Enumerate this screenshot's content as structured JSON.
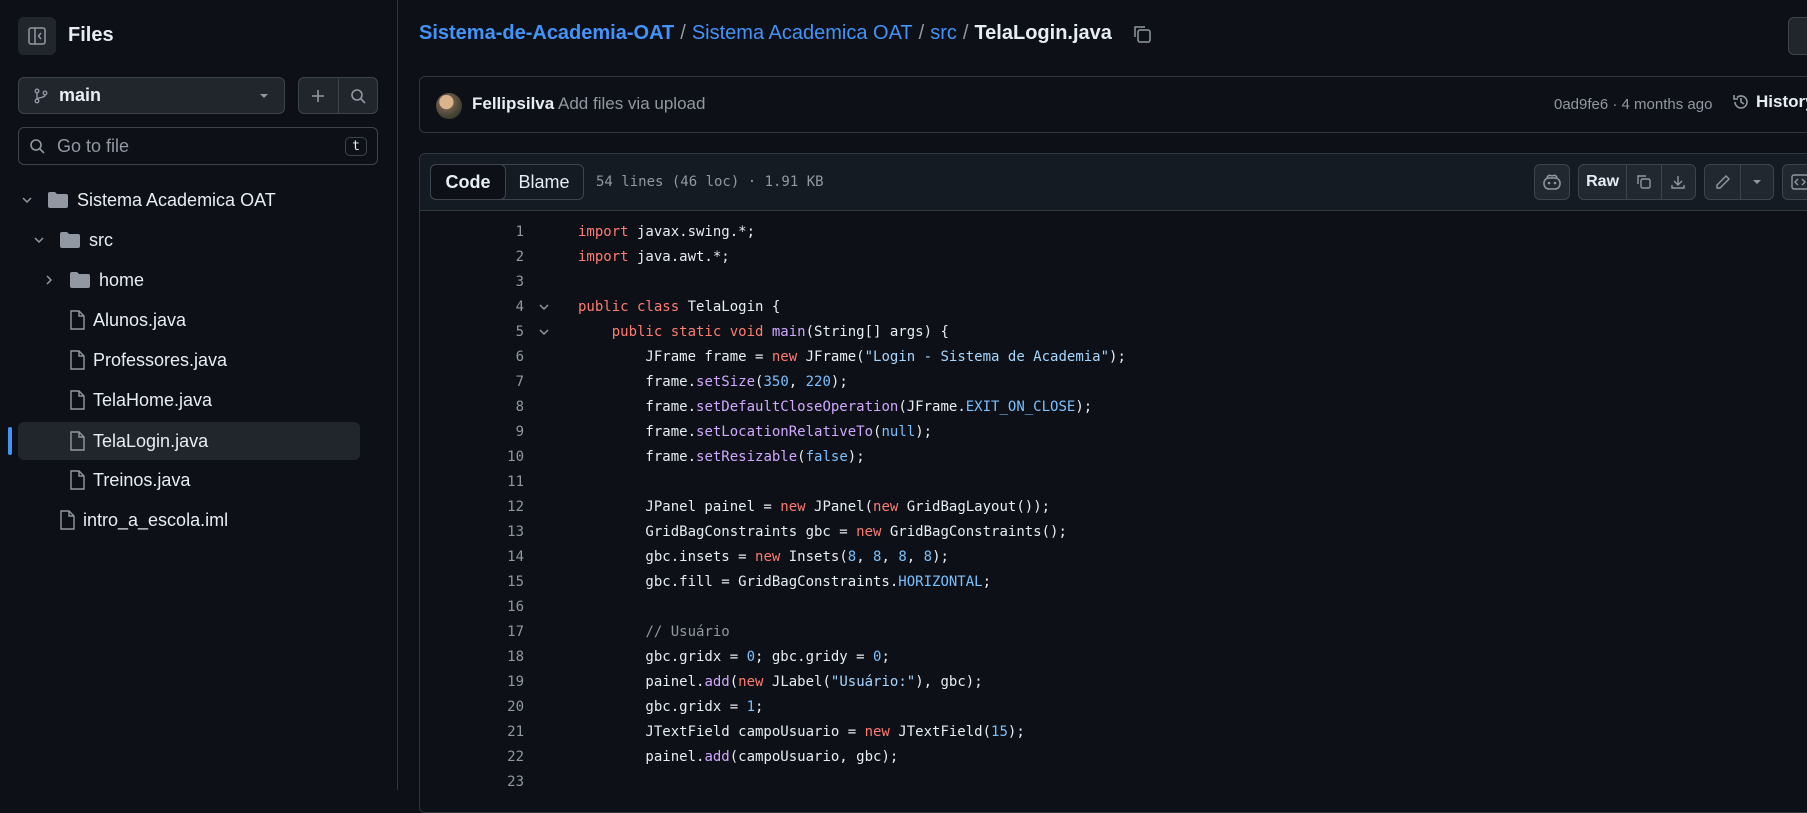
{
  "sidebar": {
    "title": "Files",
    "branch": "main",
    "goto_placeholder": "Go to file",
    "goto_shortcut": "t",
    "tree": [
      {
        "label": "Sistema Academica OAT",
        "type": "folder",
        "expanded": true
      },
      {
        "label": "src",
        "type": "folder",
        "expanded": true
      },
      {
        "label": "home",
        "type": "folder",
        "expanded": false
      },
      {
        "label": "Alunos.java",
        "type": "file"
      },
      {
        "label": "Professores.java",
        "type": "file"
      },
      {
        "label": "TelaHome.java",
        "type": "file"
      },
      {
        "label": "TelaLogin.java",
        "type": "file",
        "selected": true
      },
      {
        "label": "Treinos.java",
        "type": "file"
      },
      {
        "label": "intro_a_escola.iml",
        "type": "file"
      }
    ]
  },
  "breadcrumb": {
    "repo": "Sistema-de-Academia-OAT",
    "folder": "Sistema Academica OAT",
    "sub": "src",
    "file": "TelaLogin.java",
    "separator": "/"
  },
  "commit": {
    "author": "Fellipsilva",
    "message": "Add files via upload",
    "hash_age": "0ad9fe6 · 4 months ago",
    "history_label": "History"
  },
  "file_header": {
    "tab_code": "Code",
    "tab_blame": "Blame",
    "meta": "54 lines (46 loc) · 1.91 KB",
    "raw_label": "Raw"
  },
  "colors": {
    "accent": "#4493f8",
    "bg": "#0d1117",
    "keyword": "#ff7b72",
    "function": "#d2a8ff",
    "string": "#a5d6ff",
    "number": "#79c0ff"
  },
  "code_lines": [
    "1",
    "2",
    "3",
    "4",
    "5",
    "6",
    "7",
    "8",
    "9",
    "10",
    "11",
    "12",
    "13",
    "14",
    "15",
    "16",
    "17",
    "18",
    "19",
    "20",
    "21",
    "22",
    "23"
  ]
}
